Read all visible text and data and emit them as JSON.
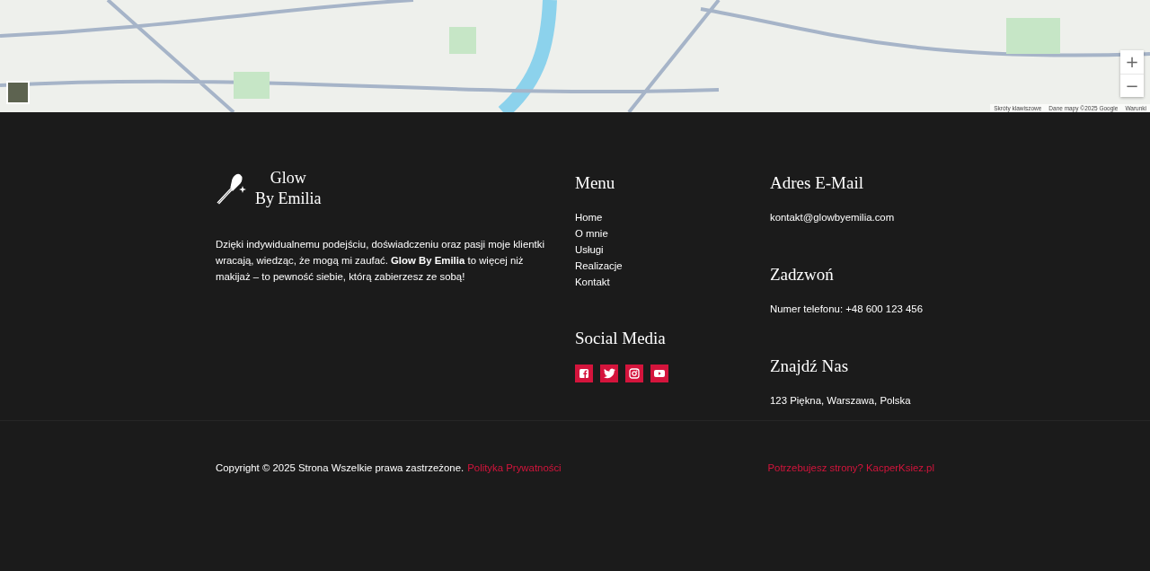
{
  "map": {
    "zoom_controls": [
      "+",
      "−"
    ],
    "attribution": [
      "Skróty klawiszowe",
      "Dane mapy ©2025 Google",
      "Warunki"
    ]
  },
  "brand": {
    "name_line_1": "Glow",
    "name_line_2": "By Emilia",
    "description": "Dzięki indywidualnemu podejściu, doświadczeniu oraz pasji moje klientki wracają, wiedząc, że mogą mi zaufać. **Glow By Emilia** to więcej niż makijaż – to pewność siebie, którą zabierzesz ze sobą!"
  },
  "menu": {
    "title": "Menu",
    "items": [
      "Home",
      "O mnie",
      "Usługi",
      "Realizacje",
      "Kontakt"
    ]
  },
  "social": {
    "title": "Social Media",
    "icons": [
      {
        "kind": "facebook"
      },
      {
        "kind": "twitter"
      },
      {
        "kind": "instagram"
      },
      {
        "kind": "youtube"
      }
    ]
  },
  "contact": [
    {
      "title": "Adres E-Mail",
      "text": "kontakt@glowbyemilia.com"
    },
    {
      "title": "Zadzwoń",
      "text": "Numer telefonu: +48 600 123 456"
    },
    {
      "title": "Znajdź Nas",
      "text": "123 Piękna, Warszawa, Polska"
    }
  ],
  "bottom_bar": {
    "copyright": "Copyright © 2025 Strona Wszelkie prawa zastrzeżone.",
    "privacy_link": "Polityka Prywatności",
    "credit_link": "Potrzebujesz strony? KacperKsiez.pl"
  }
}
